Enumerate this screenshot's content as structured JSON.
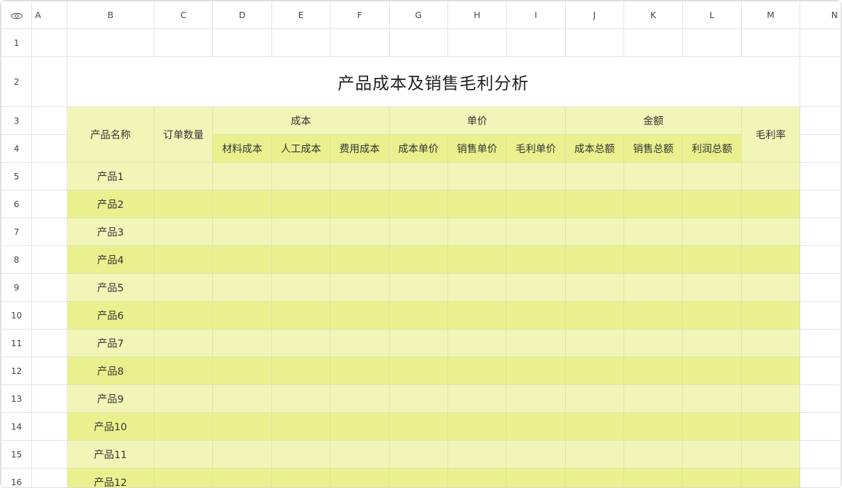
{
  "columns": [
    "A",
    "B",
    "C",
    "D",
    "E",
    "F",
    "G",
    "H",
    "I",
    "J",
    "K",
    "L",
    "M",
    "N"
  ],
  "rows": [
    "1",
    "2",
    "3",
    "4",
    "5",
    "6",
    "7",
    "8",
    "9",
    "10",
    "11",
    "12",
    "13",
    "14",
    "15",
    "16"
  ],
  "title": "产品成本及销售毛利分析",
  "headers": {
    "product_name": "产品名称",
    "order_qty": "订单数量",
    "cost_group": "成本",
    "unit_price_group": "单价",
    "amount_group": "金额",
    "gross_margin_rate": "毛利率",
    "material_cost": "材料成本",
    "labor_cost": "人工成本",
    "expense_cost": "费用成本",
    "cost_unit_price": "成本单价",
    "sales_unit_price": "销售单价",
    "gross_profit_unit_price": "毛利单价",
    "total_cost": "成本总额",
    "total_sales": "销售总额",
    "total_profit": "利润总额"
  },
  "products": [
    "产品1",
    "产品2",
    "产品3",
    "产品4",
    "产品5",
    "产品6",
    "产品7",
    "产品8",
    "产品9",
    "产品10",
    "产品11",
    "产品12"
  ],
  "colors": {
    "band_light": "#f1f6b8",
    "band_dark": "#eaf08e",
    "table_border": "#c7d13a"
  },
  "icons": {
    "corner": "eye-icon"
  }
}
